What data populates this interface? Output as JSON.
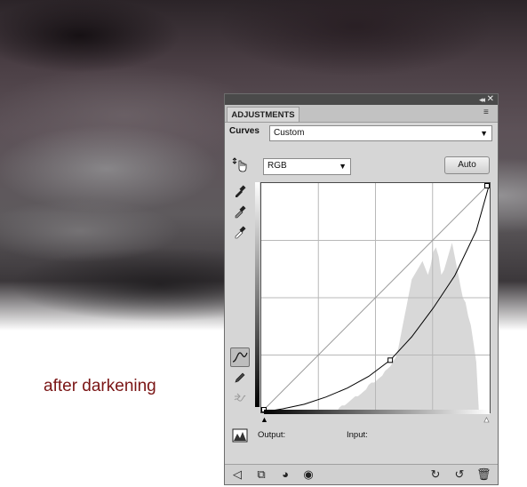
{
  "caption": "after darkening",
  "panel": {
    "tab_label": "ADJUSTMENTS",
    "collapse_glyph": "◂◂",
    "close_glyph": "✕",
    "menu_glyph": "≡",
    "adjustment_label": "Curves",
    "preset_value": "Custom",
    "channel_value": "RGB",
    "auto_label": "Auto",
    "output_label": "Output:",
    "input_label": "Input:"
  },
  "icons": {
    "on_image_adjust": "target-adjust-icon",
    "eyedropper_black": "eyedropper-black-icon",
    "eyedropper_gray": "eyedropper-gray-icon",
    "eyedropper_white": "eyedropper-white-icon",
    "curve_point_tool": "curve-point-icon",
    "pencil_tool": "pencil-icon",
    "smooth_tool": "smooth-icon",
    "clipping_warning": "clipping-warning-icon",
    "back": "back-arrow-icon",
    "clip_to_layer": "clip-to-layer-icon",
    "visibility_toggle": "visibility-icon",
    "view_previous": "eye-icon",
    "reset": "reset-icon",
    "delete": "trash-icon"
  },
  "chart_data": {
    "type": "line",
    "series": [
      {
        "values": [
          [
            0,
            0
          ],
          [
            24,
            4
          ],
          [
            48,
            9
          ],
          [
            72,
            17
          ],
          [
            96,
            27
          ],
          [
            120,
            40
          ],
          [
            144,
            58
          ],
          [
            168,
            84
          ],
          [
            192,
            116
          ],
          [
            216,
            152
          ],
          [
            240,
            202
          ],
          [
            255,
            255
          ]
        ]
      }
    ],
    "control_points": [
      [
        0,
        0
      ],
      [
        144,
        58
      ],
      [
        255,
        255
      ]
    ],
    "histogram": [
      0,
      0,
      0,
      0,
      0,
      0,
      0,
      0,
      0,
      0,
      0,
      0,
      0,
      0,
      0,
      0,
      0,
      0,
      0,
      0,
      0,
      0,
      0,
      0,
      0,
      0,
      0,
      0,
      0,
      2,
      3,
      3,
      4,
      5,
      6,
      7,
      7,
      8,
      9,
      10,
      12,
      13,
      13,
      14,
      15,
      16,
      18,
      19,
      20,
      22,
      24,
      28,
      34,
      40,
      46,
      52,
      58,
      60,
      62,
      64,
      66,
      63,
      60,
      64,
      70,
      72,
      68,
      60,
      62,
      66,
      70,
      74,
      68,
      62,
      56,
      50,
      48,
      42,
      38,
      30,
      22,
      0,
      0,
      0,
      0,
      0
    ],
    "xlim": [
      0,
      255
    ],
    "ylim": [
      0,
      255
    ],
    "grid": true
  }
}
